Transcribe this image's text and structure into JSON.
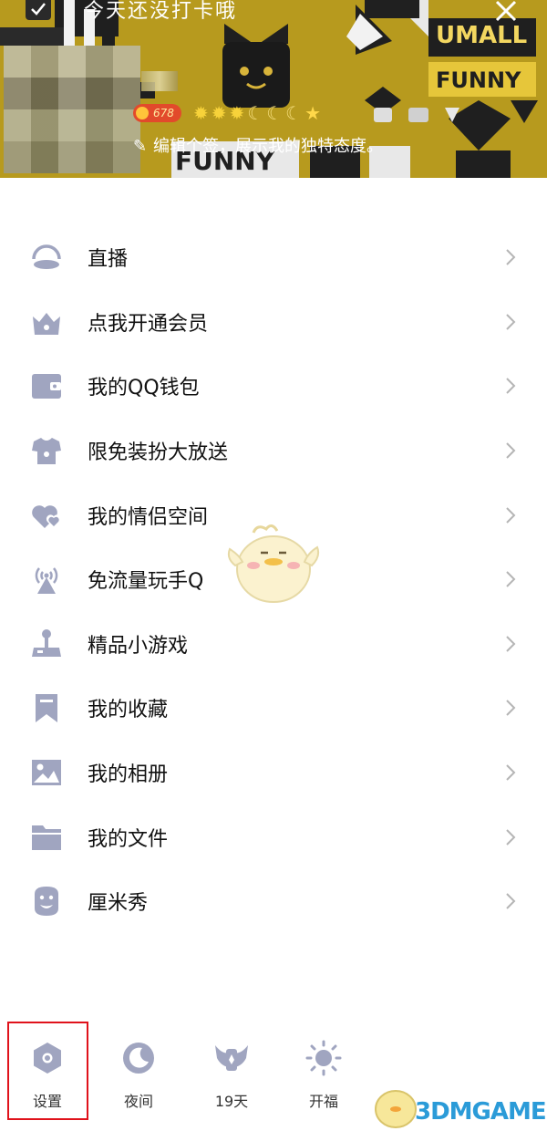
{
  "header": {
    "banner_text": "今天还没打卡哦",
    "level": "678",
    "signature": "编辑个签，展示我的独特态度。",
    "decor_text": [
      "UMALL",
      "FUNNY",
      "FUNNY"
    ],
    "colors": {
      "banner_bg": "#b79a1e",
      "level_badge": "#e24a2b"
    }
  },
  "menu": {
    "items": [
      {
        "label": "直播",
        "icon": "live-icon"
      },
      {
        "label": "点我开通会员",
        "icon": "crown-icon"
      },
      {
        "label": "我的QQ钱包",
        "icon": "wallet-icon"
      },
      {
        "label": "限免装扮大放送",
        "icon": "tshirt-icon"
      },
      {
        "label": "我的情侣空间",
        "icon": "hearts-icon"
      },
      {
        "label": "免流量玩手Q",
        "icon": "signal-tower-icon"
      },
      {
        "label": "精品小游戏",
        "icon": "joystick-icon"
      },
      {
        "label": "我的收藏",
        "icon": "bookmark-icon"
      },
      {
        "label": "我的相册",
        "icon": "photo-icon"
      },
      {
        "label": "我的文件",
        "icon": "folder-icon"
      },
      {
        "label": "厘米秀",
        "icon": "avatar-face-icon"
      }
    ],
    "icon_color": "#a0a5c0"
  },
  "bottom": {
    "items": [
      {
        "label": "设置",
        "icon": "settings-icon"
      },
      {
        "label": "夜间",
        "icon": "moon-icon"
      },
      {
        "label": "19天",
        "icon": "wings-icon"
      },
      {
        "label": "开福",
        "icon": "sun-icon"
      }
    ],
    "highlight_color": "#e0121b"
  },
  "watermark": "3DMGAME"
}
